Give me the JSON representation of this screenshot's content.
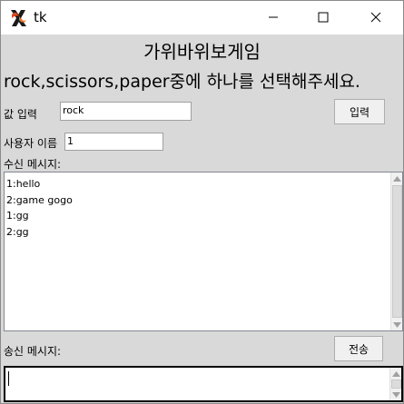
{
  "window": {
    "title": "tk"
  },
  "heading": {
    "title": "가위바위보게임",
    "instruction": "rock,scissors,paper중에 하나를 선택해주세요."
  },
  "input_row": {
    "label": "값 입력",
    "value": "rock",
    "button_label": "입력"
  },
  "user_row": {
    "label": "사용자 이름",
    "value": "1"
  },
  "received": {
    "label": "수신 메시지:",
    "messages": [
      "1:hello",
      "2:game gogo",
      "1:gg",
      "2:gg"
    ]
  },
  "send": {
    "label": "송신 메시지:",
    "button_label": "전송",
    "value": ""
  },
  "icons": {
    "app": "tk-feather-icon",
    "minimize": "minimize-icon",
    "maximize": "maximize-icon",
    "close": "close-icon"
  }
}
